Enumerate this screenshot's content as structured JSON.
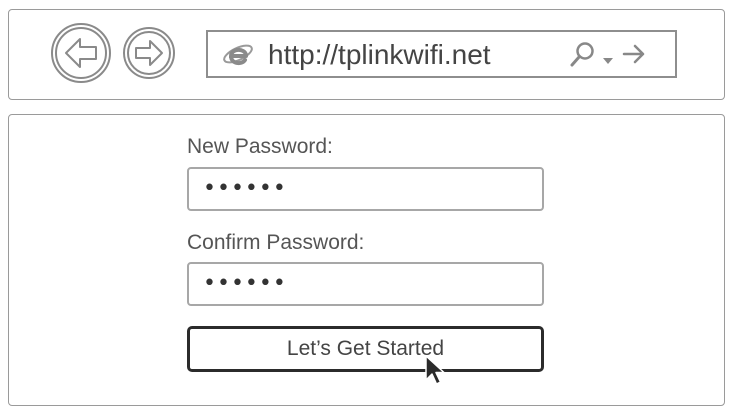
{
  "browser": {
    "url": "http://tplinkwifi.net",
    "back_icon": "back-arrow-icon",
    "forward_icon": "forward-arrow-icon",
    "browser_icon": "internet-explorer-icon",
    "search_icon": "magnifier-icon",
    "dropdown_icon": "dropdown-caret-icon",
    "go_icon": "go-arrow-icon"
  },
  "form": {
    "new_password_label": "New Password:",
    "new_password_value": "••••••",
    "confirm_password_label": "Confirm Password:",
    "confirm_password_value": "••••••",
    "submit_label": "Let’s Get Started"
  },
  "colors": {
    "border": "#9a9a9a",
    "text": "#444444",
    "button_border": "#2b2b2b"
  }
}
